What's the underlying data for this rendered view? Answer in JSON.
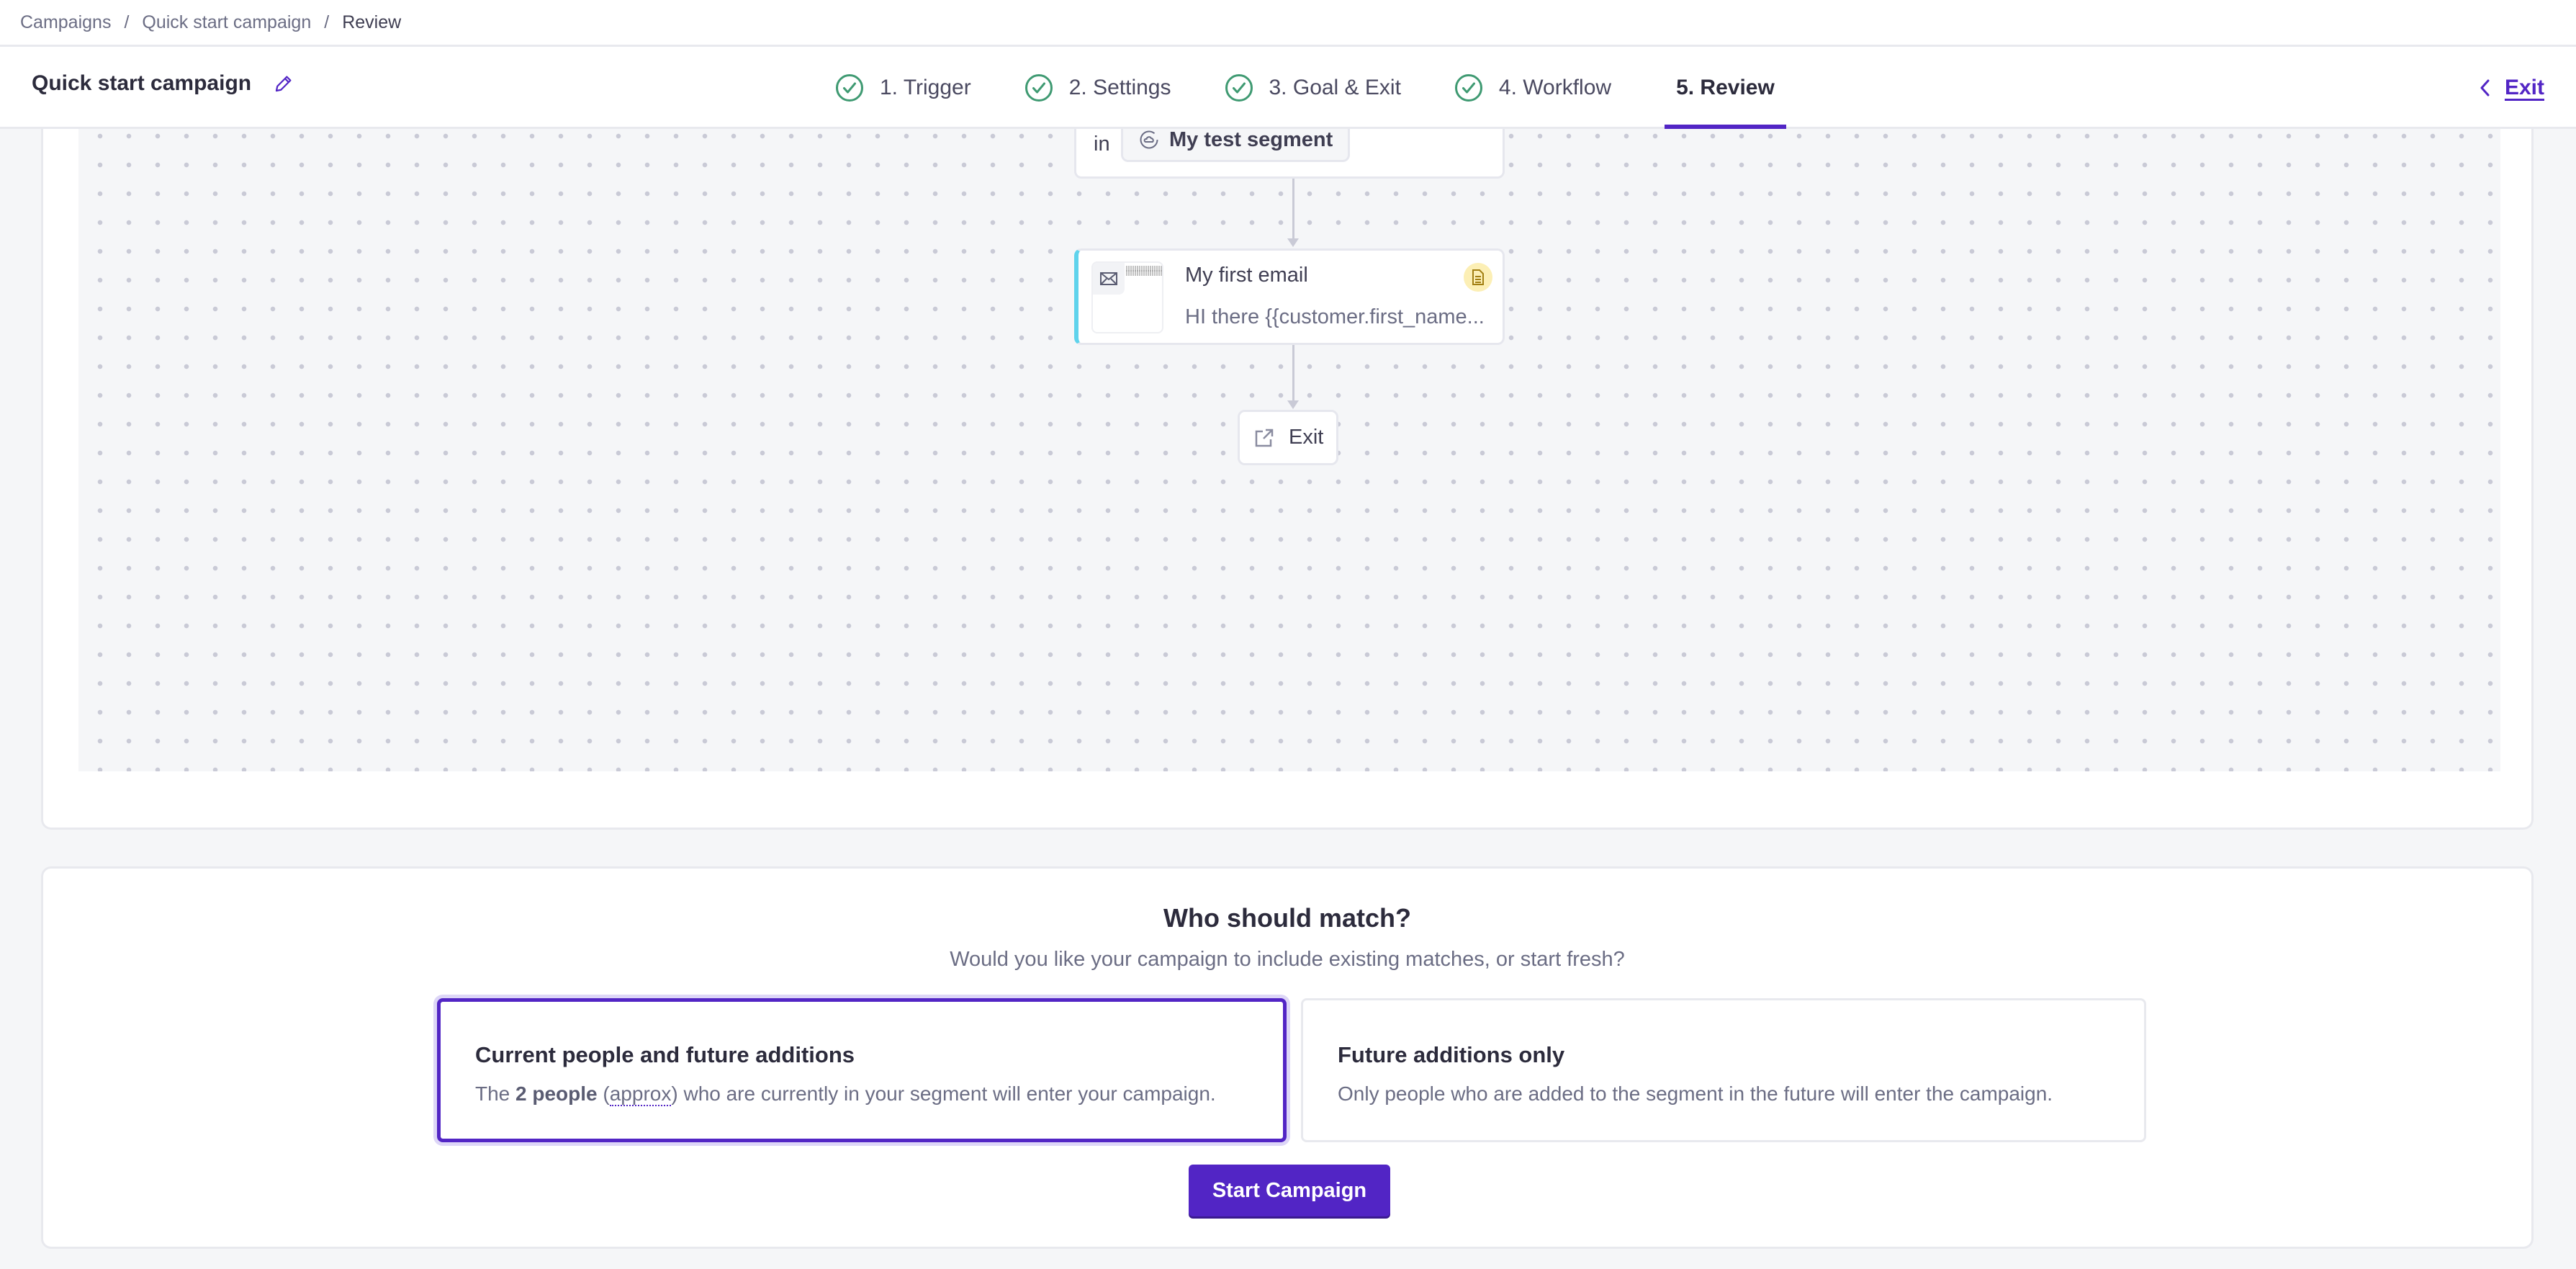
{
  "breadcrumb": {
    "items": [
      {
        "label": "Campaigns"
      },
      {
        "label": "Quick start campaign"
      },
      {
        "label": "Review"
      }
    ],
    "separator": "/"
  },
  "header": {
    "title": "Quick start campaign",
    "edit_icon": "pencil-icon",
    "steps": [
      {
        "label": "1. Trigger",
        "status": "complete",
        "icon": "check-circle-icon"
      },
      {
        "label": "2. Settings",
        "status": "complete",
        "icon": "check-circle-icon"
      },
      {
        "label": "3. Goal & Exit",
        "status": "complete",
        "icon": "check-circle-icon"
      },
      {
        "label": "4. Workflow",
        "status": "complete",
        "icon": "check-circle-icon"
      },
      {
        "label": "5. Review",
        "status": "active"
      }
    ],
    "exit_label": "Exit",
    "exit_icon": "chevron-left-icon"
  },
  "workflow": {
    "segment_node": {
      "prefix": "in",
      "segment_name": "My test segment",
      "icon": "segment-icon"
    },
    "email_node": {
      "name": "My first email",
      "subject": "HI there {{customer.first_name...",
      "icon": "envelope-icon",
      "badge_icon": "document-icon"
    },
    "exit_node": {
      "label": "Exit",
      "icon": "external-link-icon"
    }
  },
  "match": {
    "title": "Who should match?",
    "subtitle": "Would you like your campaign to include existing matches, or start fresh?",
    "options": [
      {
        "title": "Current people and future additions",
        "desc_prefix": "The ",
        "count_label": "2 people",
        "approx_label": "approx",
        "desc_suffix": " who are currently in your segment will enter your campaign.",
        "selected": true
      },
      {
        "title": "Future additions only",
        "desc": "Only people who are added to the segment in the future will enter the campaign.",
        "selected": false
      }
    ],
    "start_button": "Start Campaign"
  },
  "colors": {
    "accent": "#5225c5",
    "success": "#3f9a72",
    "email_accent": "#5fd3ec",
    "badge_bg": "#fcefb5"
  }
}
